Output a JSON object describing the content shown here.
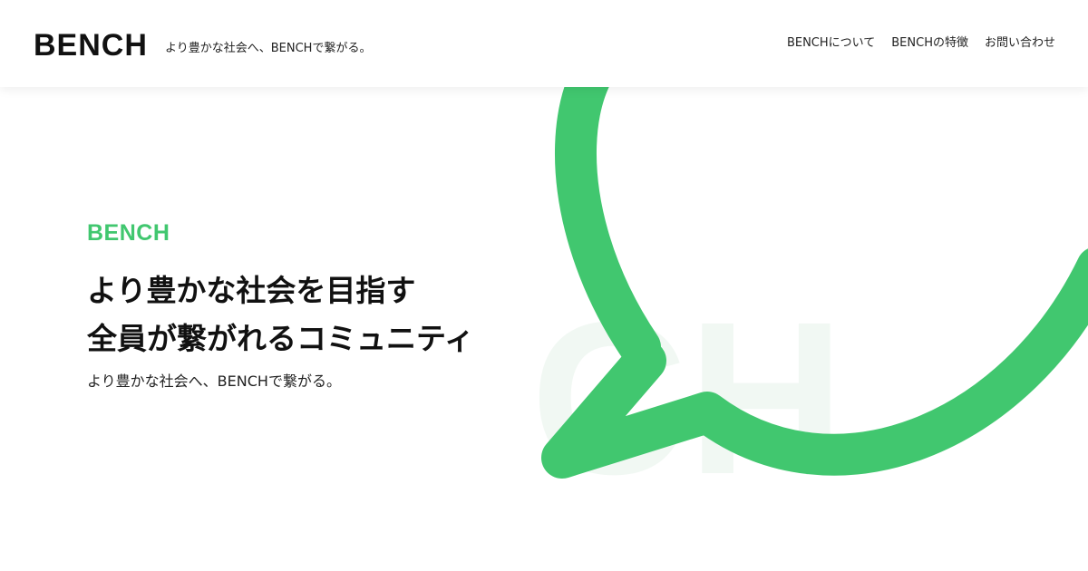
{
  "header": {
    "logo": "BENCH",
    "tagline": "より豊かな社会へ、BENCHで繋がる。",
    "nav": [
      {
        "label": "BENCHについて"
      },
      {
        "label": "BENCHの特徴"
      },
      {
        "label": "お問い合わせ"
      }
    ]
  },
  "hero": {
    "brand": "BENCH",
    "title_line1": "より豊かな社会を目指す",
    "title_line2": "全員が繋がれるコミュニティ",
    "subtitle": "より豊かな社会へ、BENCHで繋がる。"
  },
  "decor": {
    "bubble_icon": "speech-bubble-icon",
    "watermark_text": "CH"
  },
  "colors": {
    "accent": "#41c76f",
    "watermark": "#f1f8f3",
    "text": "#111111",
    "background": "#ffffff"
  }
}
